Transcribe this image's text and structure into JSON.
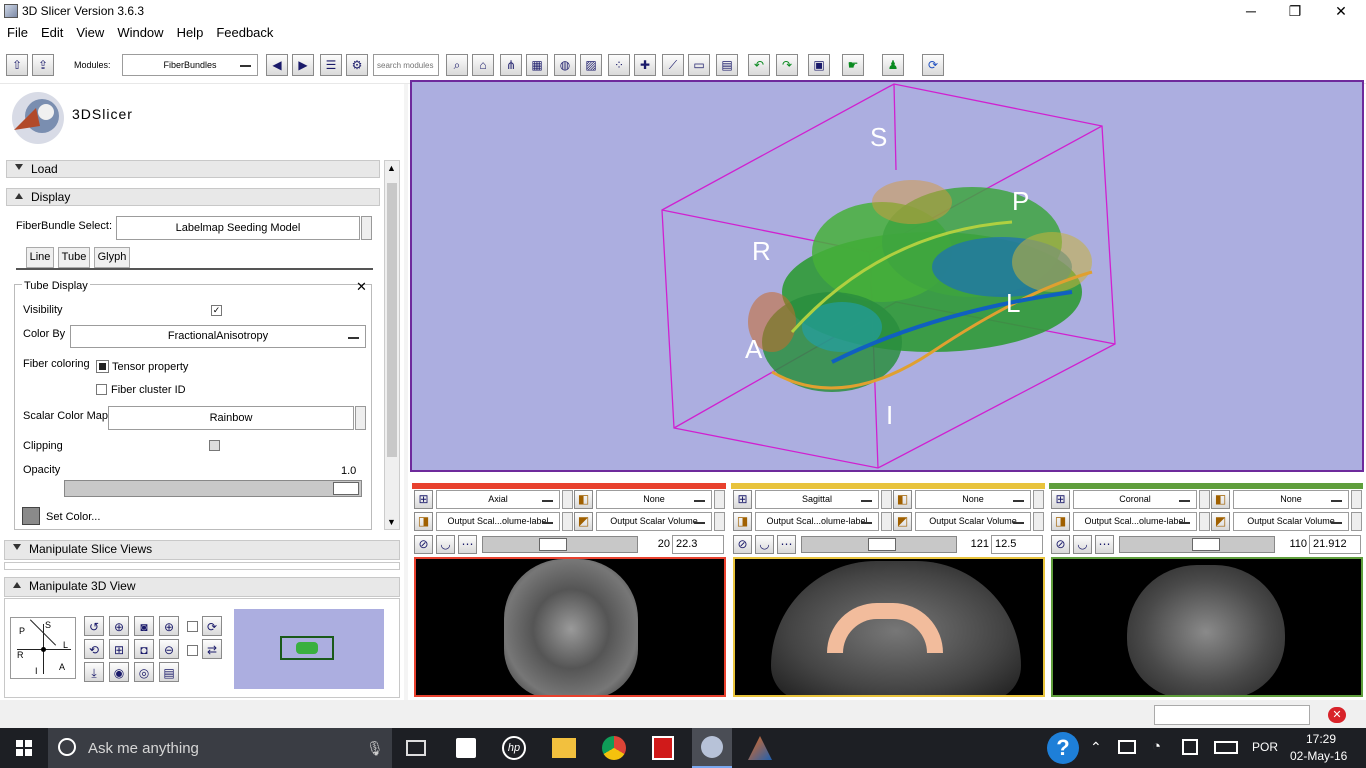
{
  "window": {
    "title": "3D Slicer Version 3.6.3",
    "minimize": "─",
    "restore": "❐",
    "close": "✕"
  },
  "menu": [
    "File",
    "Edit",
    "View",
    "Window",
    "Help",
    "Feedback"
  ],
  "toolbar": {
    "modules_label": "Modules:",
    "module_value": "FiberBundles",
    "search_placeholder": "search modules"
  },
  "logo_text": "3DSlicer",
  "sections": {
    "load": "Load",
    "display": "Display",
    "manip_slice": "Manipulate Slice Views",
    "manip_3d": "Manipulate 3D View"
  },
  "display": {
    "fiberbundle_label": "FiberBundle Select:",
    "fiberbundle_value": "Labelmap Seeding Model",
    "tabs": [
      "Line",
      "Tube",
      "Glyph"
    ],
    "tube_title": "Tube Display",
    "visibility_label": "Visibility",
    "colorby_label": "Color By",
    "colorby_value": "FractionalAnisotropy",
    "fiber_coloring_label": "Fiber coloring",
    "tensor_label": "Tensor property",
    "cluster_label": "Fiber cluster ID",
    "scalar_map_label": "Scalar Color Map",
    "scalar_map_value": "Rainbow",
    "clipping_label": "Clipping",
    "opacity_label": "Opacity",
    "opacity_value": "1.0",
    "opacity_fraction": 1.0,
    "setcolor_label": "Set Color..."
  },
  "orient": {
    "P": "P",
    "S": "S",
    "L": "L",
    "R": "R",
    "I": "I",
    "A": "A"
  },
  "view3d_labels": {
    "S": "S",
    "P": "P",
    "R": "R",
    "L": "L",
    "A": "A",
    "I": "I"
  },
  "slices": [
    {
      "name": "Axial",
      "bg": "None",
      "fg": "Output Scal...olume-label",
      "vol": "Output Scalar Volume",
      "index": "20",
      "offset": "22.3",
      "color": "#e8412e"
    },
    {
      "name": "Sagittal",
      "bg": "None",
      "fg": "Output Scal...olume-label",
      "vol": "Output Scalar Volume",
      "index": "121",
      "offset": "12.5",
      "color": "#e8c33c"
    },
    {
      "name": "Coronal",
      "bg": "None",
      "fg": "Output Scal...olume-label",
      "vol": "Output Scalar Volume",
      "index": "110",
      "offset": "21.912",
      "color": "#5f9e3c"
    }
  ],
  "taskbar": {
    "search": "Ask me anything",
    "lang": "POR",
    "time": "17:29",
    "date": "02-May-16"
  },
  "colors": {
    "view3d_bg": "#acaee0",
    "box": "#d020d0",
    "axial": "#e8412e",
    "sagittal": "#e8c33c",
    "coronal": "#5f9e3c"
  }
}
